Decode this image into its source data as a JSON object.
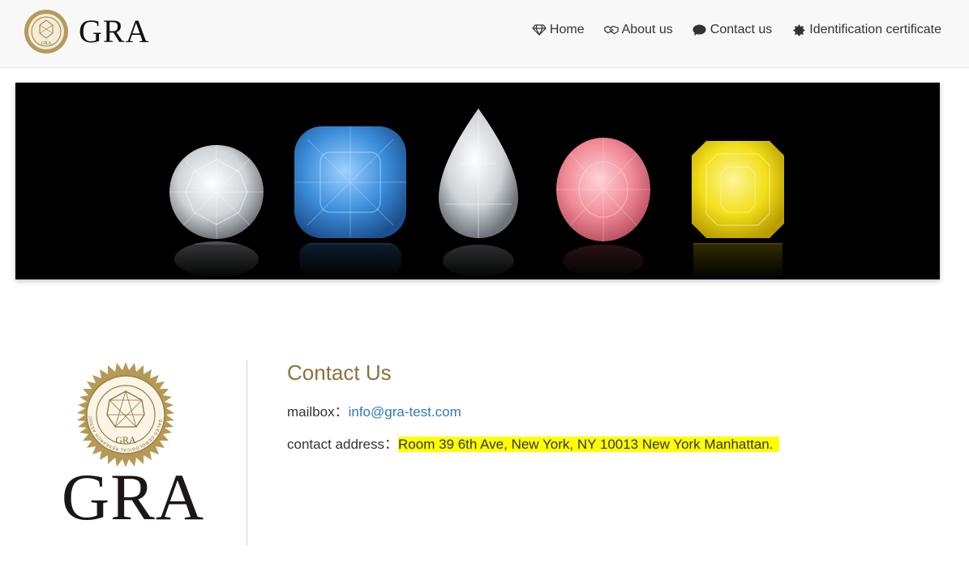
{
  "header": {
    "brand_name": "GRA",
    "seal_label": "GRA",
    "nav": [
      {
        "icon": "diamond-icon",
        "label": "Home"
      },
      {
        "icon": "handshake-icon",
        "label": "About us"
      },
      {
        "icon": "chat-bubble-icon",
        "label": "Contact us"
      },
      {
        "icon": "certificate-badge-icon",
        "label": "Identification certificate"
      }
    ]
  },
  "banner": {
    "gems": [
      "white round diamond",
      "blue cushion diamond",
      "white pear diamond",
      "pink oval diamond",
      "yellow emerald-cut diamond"
    ]
  },
  "logo": {
    "seal_ring_text": "GALES GEMOLOGICAL RESEARCH ASSOCIATION",
    "seal_label": "GRA",
    "wordmark": "GRA"
  },
  "contact": {
    "title": "Contact Us",
    "mailbox_label": "mailbox：",
    "email": "info@gra-test.com",
    "address_label": "contact address：",
    "address": "Room 39 6th Ave, New York, NY 10013 New York Manhattan."
  },
  "colors": {
    "gold": "#8a7240",
    "link": "#337ab7",
    "highlight": "#ffff00",
    "header_bg": "#f8f8f8"
  }
}
